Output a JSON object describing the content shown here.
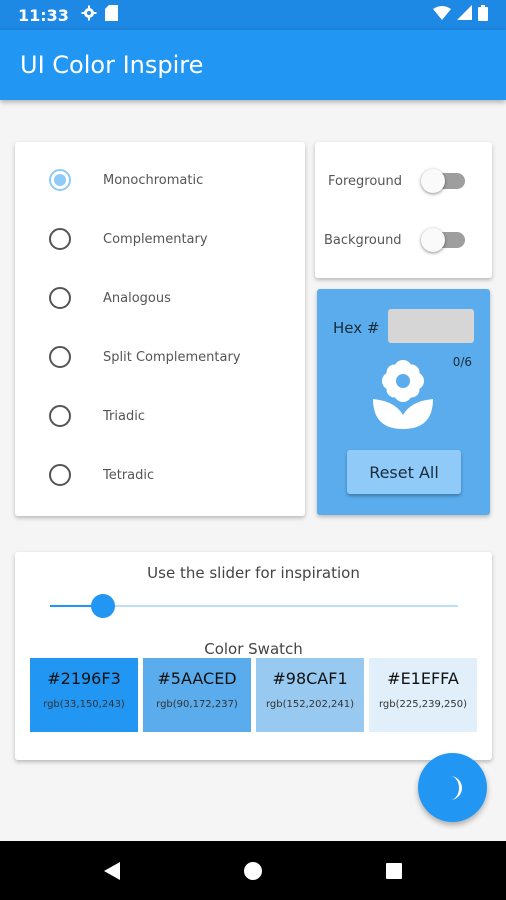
{
  "status_bar": {
    "time": "11:33"
  },
  "app_bar": {
    "title": "UI Color Inspire"
  },
  "color_schemes": [
    {
      "label": "Monochromatic",
      "selected": true
    },
    {
      "label": "Complementary",
      "selected": false
    },
    {
      "label": "Analogous",
      "selected": false
    },
    {
      "label": "Split Complementary",
      "selected": false
    },
    {
      "label": "Triadic",
      "selected": false
    },
    {
      "label": "Tetradic",
      "selected": false
    }
  ],
  "toggles": [
    {
      "label": "Foreground",
      "on": false
    },
    {
      "label": "Background",
      "on": false
    }
  ],
  "hex_panel": {
    "label": "Hex #",
    "input_value": "",
    "counter": "0/6",
    "reset_label": "Reset All"
  },
  "slider": {
    "title": "Use the slider for inspiration",
    "value": 0.13
  },
  "swatch": {
    "title": "Color Swatch",
    "colors": [
      {
        "hex": "#2196F3",
        "rgb": "rgb(33,150,243)",
        "color": "#2196F3"
      },
      {
        "hex": "#5AACED",
        "rgb": "rgb(90,172,237)",
        "color": "#5AACED"
      },
      {
        "hex": "#98CAF1",
        "rgb": "rgb(152,202,241)",
        "color": "#98CAF1"
      },
      {
        "hex": "#E1EFFA",
        "rgb": "rgb(225,239,250)",
        "color": "#E1EFFA"
      }
    ]
  },
  "theme_colors": {
    "primary": "#2196F3",
    "status_bar": "#1E88E5",
    "accent_light": "#90CAF9"
  },
  "icons": {
    "status": [
      "gear-icon",
      "sd-card-icon",
      "wifi-icon",
      "signal-icon",
      "battery-icon"
    ],
    "hex_panel": "flower-icon",
    "fab": "moon-icon",
    "nav": [
      "back-icon",
      "home-icon",
      "recents-icon"
    ]
  }
}
